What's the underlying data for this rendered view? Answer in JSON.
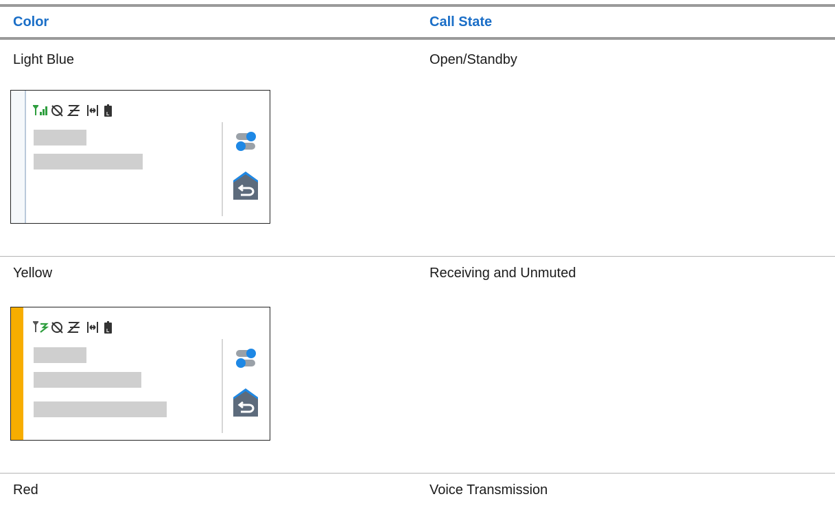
{
  "table": {
    "headers": {
      "color": "Color",
      "call_state": "Call State"
    },
    "rows": [
      {
        "color": "Light Blue",
        "call_state": "Open/Standby",
        "indicator_color": "#f5f8fb"
      },
      {
        "color": "Yellow",
        "call_state": "Receiving and Unmuted",
        "indicator_color": "#f7ad00"
      },
      {
        "color": "Red",
        "call_state": "Voice Transmission",
        "indicator_color": "#d0021b"
      }
    ]
  },
  "icons": {
    "signal": "signal-strength-icon",
    "scan_off": "scan-off-icon",
    "talkaround": "talkaround-icon",
    "channel": "channel-spacing-icon",
    "battery": "battery-low-icon",
    "toggle": "toggle-icon",
    "back": "back-home-icon"
  },
  "colors": {
    "header_text": "#1a6ec7",
    "accent_blue": "#1e88e5",
    "icon_slate": "#5d6b7c"
  }
}
